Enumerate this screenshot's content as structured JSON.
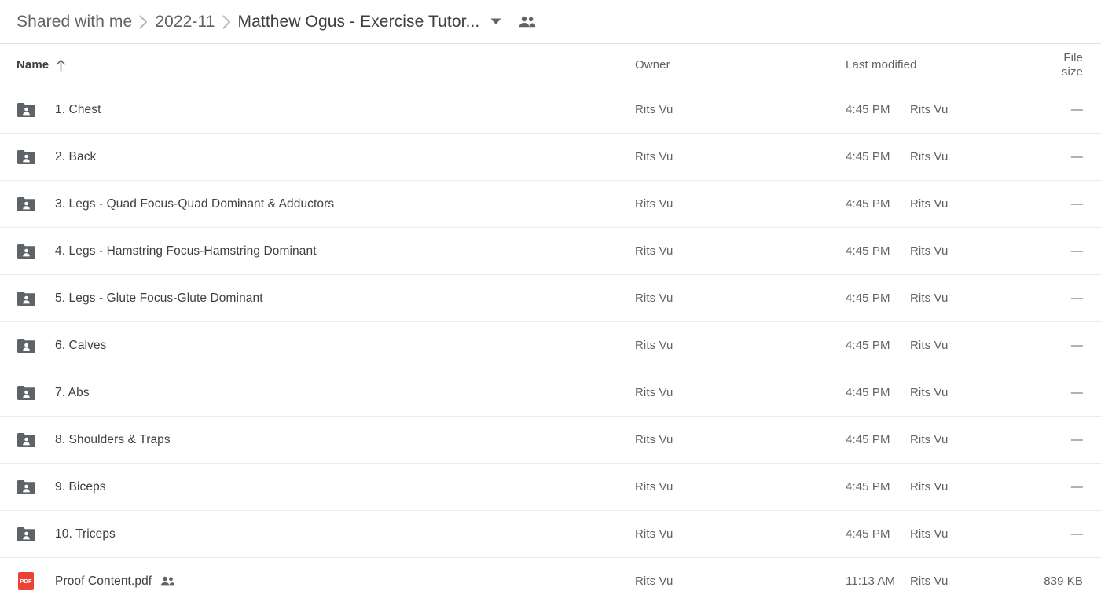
{
  "breadcrumb": {
    "items": [
      {
        "label": "Shared with me",
        "current": false
      },
      {
        "label": "2022-11",
        "current": false
      },
      {
        "label": "Matthew Ogus - Exercise Tutor...",
        "current": true
      }
    ],
    "separator": "chevron-right-icon",
    "caret": "chevron-down-icon",
    "shared_icon": "people-icon"
  },
  "table": {
    "headers": {
      "name": "Name",
      "owner": "Owner",
      "modified": "Last modified",
      "size": "File size"
    },
    "sort": {
      "column": "Name",
      "direction": "ascending",
      "icon": "arrow-up-icon"
    },
    "rows": [
      {
        "icon": "shared-folder-icon",
        "type": "folder",
        "name": "1. Chest",
        "owner": "Rits Vu",
        "modified_time": "4:45 PM",
        "modified_by": "Rits Vu",
        "size": "—",
        "shared_badge": false
      },
      {
        "icon": "shared-folder-icon",
        "type": "folder",
        "name": "2. Back",
        "owner": "Rits Vu",
        "modified_time": "4:45 PM",
        "modified_by": "Rits Vu",
        "size": "—",
        "shared_badge": false
      },
      {
        "icon": "shared-folder-icon",
        "type": "folder",
        "name": "3. Legs - Quad Focus-Quad Dominant & Adductors",
        "owner": "Rits Vu",
        "modified_time": "4:45 PM",
        "modified_by": "Rits Vu",
        "size": "—",
        "shared_badge": false
      },
      {
        "icon": "shared-folder-icon",
        "type": "folder",
        "name": "4. Legs - Hamstring Focus-Hamstring Dominant",
        "owner": "Rits Vu",
        "modified_time": "4:45 PM",
        "modified_by": "Rits Vu",
        "size": "—",
        "shared_badge": false
      },
      {
        "icon": "shared-folder-icon",
        "type": "folder",
        "name": "5. Legs - Glute Focus-Glute Dominant",
        "owner": "Rits Vu",
        "modified_time": "4:45 PM",
        "modified_by": "Rits Vu",
        "size": "—",
        "shared_badge": false
      },
      {
        "icon": "shared-folder-icon",
        "type": "folder",
        "name": "6. Calves",
        "owner": "Rits Vu",
        "modified_time": "4:45 PM",
        "modified_by": "Rits Vu",
        "size": "—",
        "shared_badge": false
      },
      {
        "icon": "shared-folder-icon",
        "type": "folder",
        "name": "7. Abs",
        "owner": "Rits Vu",
        "modified_time": "4:45 PM",
        "modified_by": "Rits Vu",
        "size": "—",
        "shared_badge": false
      },
      {
        "icon": "shared-folder-icon",
        "type": "folder",
        "name": "8. Shoulders & Traps",
        "owner": "Rits Vu",
        "modified_time": "4:45 PM",
        "modified_by": "Rits Vu",
        "size": "—",
        "shared_badge": false
      },
      {
        "icon": "shared-folder-icon",
        "type": "folder",
        "name": "9. Biceps",
        "owner": "Rits Vu",
        "modified_time": "4:45 PM",
        "modified_by": "Rits Vu",
        "size": "—",
        "shared_badge": false
      },
      {
        "icon": "shared-folder-icon",
        "type": "folder",
        "name": "10. Triceps",
        "owner": "Rits Vu",
        "modified_time": "4:45 PM",
        "modified_by": "Rits Vu",
        "size": "—",
        "shared_badge": false
      },
      {
        "icon": "pdf-file-icon",
        "type": "pdf",
        "icon_label": "PDF",
        "name": "Proof Content.pdf",
        "owner": "Rits Vu",
        "modified_time": "11:13 AM",
        "modified_by": "Rits Vu",
        "size": "839 KB",
        "shared_badge": true
      }
    ]
  },
  "colors": {
    "pdf_red": "#ea4335",
    "folder_gray": "#5f6368",
    "text_primary": "#3c4043",
    "text_secondary": "#5f6368",
    "divider": "#e8eaed"
  }
}
